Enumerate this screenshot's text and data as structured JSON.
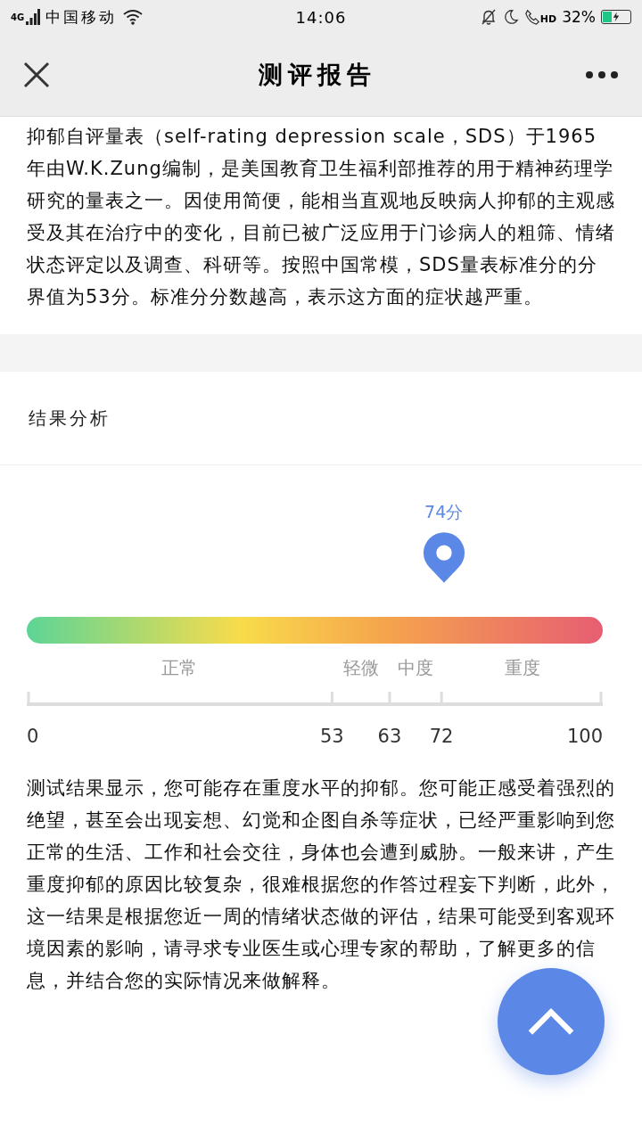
{
  "status_bar": {
    "network": "4G",
    "carrier": "中国移动",
    "time": "14:06",
    "call_badge": "HD",
    "battery_text": "32%"
  },
  "header": {
    "title": "测评报告"
  },
  "intro": "抑郁自评量表（self-rating depression scale，SDS）于1965年由W.K.Zung编制，是美国教育卫生福利部推荐的用于精神药理学研究的量表之一。因使用简便，能相当直观地反映病人抑郁的主观感受及其在治疗中的变化，目前已被广泛应用于门诊病人的粗筛、情绪状态评定以及调查、科研等。按照中国常模，SDS量表标准分的分界值为53分。标准分分数越高，表示这方面的症状越严重。",
  "section_title": "结果分析",
  "gauge": {
    "score": "74分",
    "segments": [
      {
        "label": "正常"
      },
      {
        "label": "轻微"
      },
      {
        "label": "中度"
      },
      {
        "label": "重度"
      }
    ],
    "ticks": [
      {
        "label": "0"
      },
      {
        "label": "53"
      },
      {
        "label": "63"
      },
      {
        "label": "72"
      },
      {
        "label": "100"
      }
    ]
  },
  "conclusion": "测试结果显示，您可能存在重度水平的抑郁。您可能正感受着强烈的绝望，甚至会出现妄想、幻觉和企图自杀等症状，已经严重影响到您正常的生活、工作和社会交往，身体也会遭到威胁。一般来讲，产生重度抑郁的原因比较复杂，很难根据您的作答过程妄下判断，此外，这一结果是根据您近一周的情绪状态做的评估，结果可能受到客观环境因素的影响，请寻求专业医生或心理专家的帮助，了解更多的信息，并结合您的实际情况来做解释。"
}
